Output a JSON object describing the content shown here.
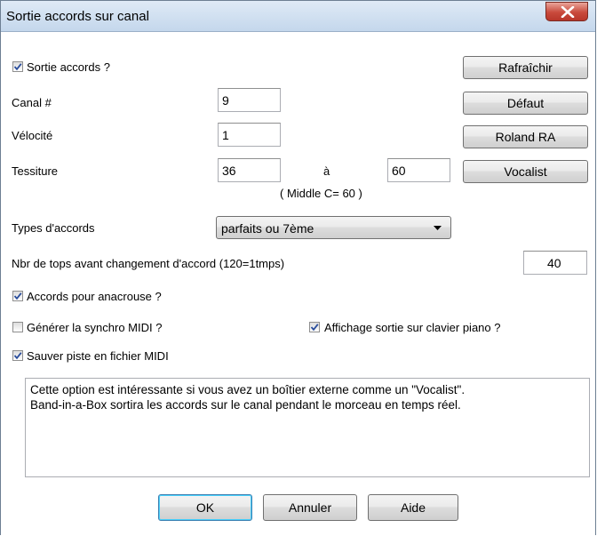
{
  "window": {
    "title": "Sortie accords sur canal"
  },
  "checkbox_sortie": {
    "label": "Sortie accords ?",
    "checked": true
  },
  "canal": {
    "label": "Canal #",
    "value": "9"
  },
  "velocite": {
    "label": "Vélocité",
    "value": "1"
  },
  "tessiture": {
    "label": "Tessiture",
    "from": "36",
    "to_label": "à",
    "to": "60",
    "hint": "( Middle C= 60 )"
  },
  "types": {
    "label": "Types d'accords",
    "selected": "parfaits ou 7ème"
  },
  "ticks": {
    "label": "Nbr de tops avant changement d'accord (120=1tmps)",
    "value": "40"
  },
  "options": {
    "anacrouse": {
      "label": "Accords pour anacrouse ?",
      "checked": true
    },
    "synchro": {
      "label": "Générer la synchro MIDI ?",
      "checked": false
    },
    "affichage": {
      "label": "Affichage sortie sur clavier piano ?",
      "checked": true
    },
    "sauver": {
      "label": "Sauver piste en fichier MIDI",
      "checked": true
    }
  },
  "side_buttons": {
    "rafraichir": "Rafraîchir",
    "defaut": "Défaut",
    "roland": "Roland RA",
    "vocalist": "Vocalist"
  },
  "description": {
    "line1": "Cette option est intéressante si vous avez un boîtier externe comme un \"Vocalist\".",
    "line2": "Band-in-a-Box  sortira les accords sur le canal pendant le morceau en temps réel."
  },
  "footer": {
    "ok": "OK",
    "cancel": "Annuler",
    "help": "Aide"
  },
  "colors": {
    "title_bar": "#c4d7ec",
    "close_button": "#c94a3c",
    "check_mark": "#2a4d9c"
  }
}
